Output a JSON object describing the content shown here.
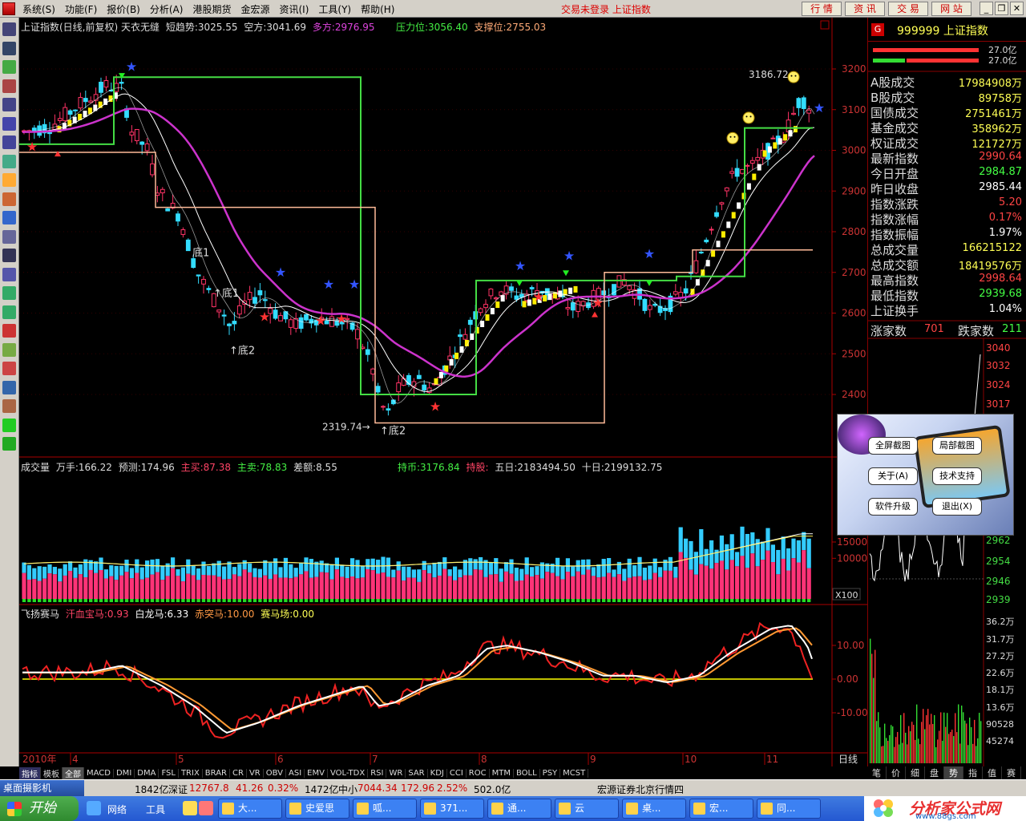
{
  "menubar": {
    "items": [
      "系统(S)",
      "功能(F)",
      "报价(B)",
      "分析(A)",
      "港股期货",
      "金宏源",
      "资讯(I)",
      "工具(Y)",
      "帮助(H)"
    ],
    "status": "交易未登录  上证指数",
    "buttons": [
      "行 情",
      "资 讯",
      "交 易",
      "网 站"
    ]
  },
  "chart_header": {
    "title": "上证指数(日线,前复权) 天衣无缝",
    "short_trend": "短趋势:3025.55",
    "kong": "空方:3041.69",
    "duo": "多方:2976.95",
    "pressure": "压力位:3056.40",
    "support": "支撑位:2755.03"
  },
  "volume_header": {
    "label": "成交量",
    "wanshou": "万手:166.22",
    "yuce": "预测:174.96",
    "zhumai": "主买:87.38",
    "zhumai2": "主卖:78.83",
    "chae": "差额:8.55",
    "chibi": "持币:3176.84",
    "chigu": "持股:",
    "wuri": "五日:2183494.50",
    "shiri": "十日:2199132.75"
  },
  "horse_header": {
    "label": "飞扬赛马",
    "hanxue": "汗血宝马:0.93",
    "bailong": "白龙马:6.33",
    "chitu": "赤突马:10.00",
    "saimachang": "赛马场:0.00"
  },
  "annotations": {
    "high": "3186.72",
    "low": "2319.74",
    "di1_a": "底1",
    "di1_b": "↑底1",
    "di2_a": "↑底2",
    "di2_b": "↑底2"
  },
  "price_axis": [
    "3200",
    "3100",
    "3000",
    "2900",
    "2800",
    "2700",
    "2600",
    "2500",
    "2400"
  ],
  "volume_axis": [
    "15000",
    "10000",
    "X100"
  ],
  "horse_axis": [
    "10.00",
    "0.00",
    "-10.00"
  ],
  "date_axis": {
    "year": "2010年",
    "months": [
      "4",
      "5",
      "6",
      "7",
      "8",
      "9",
      "10",
      "11"
    ],
    "period": "日线"
  },
  "right_panel": {
    "code": "999999",
    "name": "上证指数",
    "badge": "G",
    "bar_values": [
      "27.0亿",
      "27.0亿"
    ],
    "stats": [
      {
        "label": "A股成交",
        "value": "17984908万",
        "color": "#ffff55"
      },
      {
        "label": "B股成交",
        "value": "89758万",
        "color": "#ffff55"
      },
      {
        "label": "国债成交",
        "value": "2751461万",
        "color": "#ffff55"
      },
      {
        "label": "基金成交",
        "value": "358962万",
        "color": "#ffff55"
      },
      {
        "label": "权证成交",
        "value": "121727万",
        "color": "#ffff55"
      },
      {
        "label": "最新指数",
        "value": "2990.64",
        "color": "#ff4444"
      },
      {
        "label": "今日开盘",
        "value": "2984.87",
        "color": "#44ff44"
      },
      {
        "label": "昨日收盘",
        "value": "2985.44",
        "color": "#ffffff"
      },
      {
        "label": "指数涨跌",
        "value": "5.20",
        "color": "#ff4444"
      },
      {
        "label": "指数涨幅",
        "value": "0.17%",
        "color": "#ff4444"
      },
      {
        "label": "指数振幅",
        "value": "1.97%",
        "color": "#ffffff"
      },
      {
        "label": "总成交量",
        "value": "166215122",
        "color": "#ffff55"
      },
      {
        "label": "总成交额",
        "value": "18419576万",
        "color": "#ffff55"
      },
      {
        "label": "最高指数",
        "value": "2998.64",
        "color": "#ff4444"
      },
      {
        "label": "最低指数",
        "value": "2939.68",
        "color": "#44ff44"
      },
      {
        "label": "上证换手",
        "value": "1.04%",
        "color": "#ffffff"
      }
    ],
    "zhangjia_label": "涨家数",
    "zhangjia_value": "701",
    "diejia_label": "跌家数",
    "diejia_value": "211",
    "mini_price_axis": [
      "3040",
      "3032",
      "3024",
      "3017",
      "2962",
      "2954",
      "2946",
      "2939"
    ],
    "mini_vol_axis": [
      "36.2万",
      "31.7万",
      "27.2万",
      "22.6万",
      "18.1万",
      "13.6万",
      "90528",
      "45274"
    ],
    "tabs": [
      "笔",
      "价",
      "细",
      "盘",
      "势",
      "指",
      "值",
      "赛"
    ]
  },
  "tabs": [
    "指标",
    "模板",
    "全部",
    "MACD",
    "DMI",
    "DMA",
    "FSL",
    "TRIX",
    "BRAR",
    "CR",
    "VR",
    "OBV",
    "ASI",
    "EMV",
    "VOL-TDX",
    "RSI",
    "WR",
    "SAR",
    "KDJ",
    "CCI",
    "ROC",
    "MTM",
    "BOLL",
    "PSY",
    "MCST"
  ],
  "statusbar": {
    "camera": "桌面摄影机",
    "vol": "1842亿",
    "shenzheng_label": "深证",
    "shenzheng_val": "12767.8",
    "shenzheng_chg": "41.26",
    "shenzheng_pct": "0.32%",
    "amt": "1472亿",
    "zhongxiao_label": "中小",
    "zhongxiao_val": "7044.34",
    "zhongxiao_chg": "172.96",
    "zhongxiao_pct": "2.52%",
    "zhongxiao_amt": "502.0亿",
    "source": "宏源证券北京行情四"
  },
  "taskbar": {
    "start": "开始",
    "quick": [
      "网络",
      "工具"
    ],
    "tasks": [
      "大...",
      "史爱思",
      "呱...",
      "371...",
      "通...",
      "云",
      "桌...",
      "宏...",
      "同..."
    ],
    "logo": "分析家公式网",
    "url": "www.88gs.com"
  },
  "popup": {
    "buttons": [
      "全屏截图",
      "局部截图",
      "关于(A)",
      "技术支持",
      "软件升级",
      "退出(X)"
    ]
  },
  "colors": {
    "up": "#ff3366",
    "down": "#33ccff",
    "magenta": "#cc33cc",
    "green_line": "#44dd44",
    "peach_line": "#ffbb99",
    "yellow": "#ffff00",
    "red_axis": "#aa0000"
  }
}
